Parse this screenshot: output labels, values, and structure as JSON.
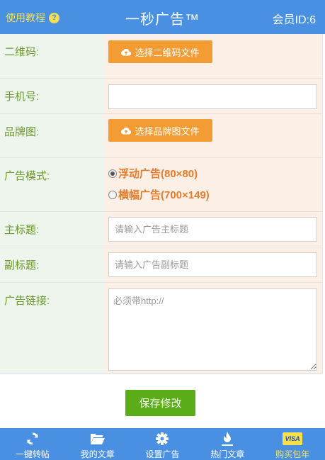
{
  "header": {
    "help_label": "使用教程",
    "help_icon": "?",
    "title": "一秒广告™",
    "member": "会员ID:6"
  },
  "form": {
    "qr": {
      "label": "二维码:",
      "button": "选择二维码文件"
    },
    "phone": {
      "label": "手机号:",
      "value": ""
    },
    "brand": {
      "label": "品牌图:",
      "button": "选择品牌图文件"
    },
    "mode": {
      "label": "广告模式:",
      "options": [
        {
          "text": "浮动广告(80×80)",
          "checked": true
        },
        {
          "text": "横幅广告(700×149)",
          "checked": false
        }
      ]
    },
    "main_title": {
      "label": "主标题:",
      "placeholder": "请输入广告主标题"
    },
    "sub_title": {
      "label": "副标题:",
      "placeholder": "请输入广告副标题"
    },
    "link": {
      "label": "广告链接:",
      "placeholder": "必须带http://"
    }
  },
  "save_label": "保存修改",
  "nav": {
    "items": [
      {
        "label": "一键转帖",
        "icon": "refresh-icon"
      },
      {
        "label": "我的文章",
        "icon": "folder-open-icon"
      },
      {
        "label": "设置广告",
        "icon": "gear-icon"
      },
      {
        "label": "热门文章",
        "icon": "flame-icon"
      },
      {
        "label": "购买包年",
        "icon": "visa-card-icon",
        "badge": "VISA"
      }
    ]
  },
  "colors": {
    "header_bg": "#4a90e2",
    "accent_yellow": "#f8e04c",
    "upload_orange": "#f39c34",
    "label_green": "#6d9a2f",
    "save_green": "#5aac19",
    "radio_orange": "#e57d2c"
  }
}
